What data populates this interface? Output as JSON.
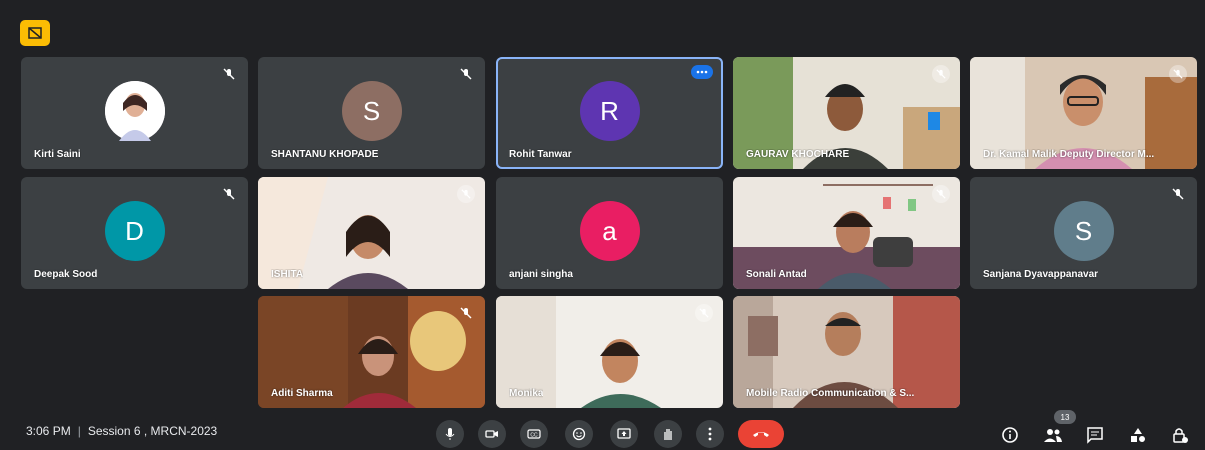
{
  "participants": [
    {
      "name": "Kirti Saini"
    },
    {
      "name": "SHANTANU KHOPADE",
      "initial": "S",
      "color": "#8d6e63"
    },
    {
      "name": "Rohit Tanwar",
      "initial": "R",
      "color": "#5e35b1"
    },
    {
      "name": "GAURAV KHOCHARE"
    },
    {
      "name": "Dr. Kamal Malik Deputy Director M..."
    },
    {
      "name": "Deepak Sood",
      "initial": "D",
      "color": "#0097a7"
    },
    {
      "name": "ISHITA"
    },
    {
      "name": "anjani singha",
      "initial": "a",
      "color": "#e91e63"
    },
    {
      "name": "Sonali Antad"
    },
    {
      "name": "Sanjana Dyavappanavar",
      "initial": "S",
      "color": "#607d8b"
    },
    {
      "name": "Aditi Sharma"
    },
    {
      "name": "Monika"
    },
    {
      "name": "Mobile Radio Communication & S..."
    }
  ],
  "meeting": {
    "time": "3:06 PM",
    "separator": "|",
    "title": "Session 6 , MRCN-2023"
  },
  "people_count": "13",
  "controls": [
    "mic-icon",
    "camera-icon",
    "captions-icon",
    "emoji-icon",
    "present-icon",
    "raise-hand-icon",
    "more-options-icon",
    "end-call-icon"
  ],
  "right_controls": [
    "info-icon",
    "people-icon",
    "chat-icon",
    "activities-icon",
    "host-controls-icon"
  ],
  "colors": {
    "background": "#202124",
    "tile": "#3c4043",
    "accent": "#8ab4f8",
    "end_call": "#ea4335",
    "badge": "#fbbc04"
  }
}
